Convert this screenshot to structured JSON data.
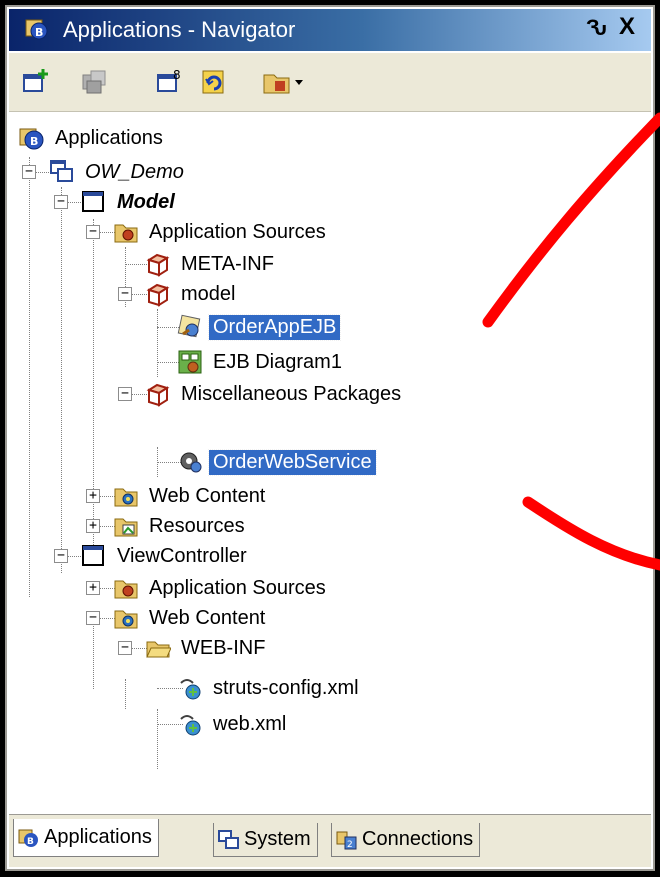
{
  "window": {
    "title": "Applications - Navigator",
    "pin_glyph": "Ԅ",
    "close_glyph": "X"
  },
  "toolbar": {
    "buttons": [
      "new-app-icon",
      "open-gray-icon",
      "new-project-icon",
      "refresh-icon",
      "folder-filter-icon"
    ]
  },
  "tree": {
    "root": "Applications",
    "workspace": "OW_Demo",
    "model": {
      "label": "Model",
      "app_sources": "Application Sources",
      "meta_inf": "META-INF",
      "pkg_model": "model",
      "order_app_ejb": "OrderAppEJB",
      "ejb_diagram": "EJB Diagram1",
      "misc_packages": "Miscellaneous Packages",
      "order_web_service": "OrderWebService",
      "web_content": "Web Content",
      "resources": "Resources"
    },
    "view_controller": {
      "label": "ViewController",
      "app_sources": "Application Sources",
      "web_content": "Web Content",
      "web_inf": "WEB-INF",
      "struts_config": "struts-config.xml",
      "web_xml": "web.xml"
    }
  },
  "tabs": [
    "Applications",
    "System",
    "Connections"
  ],
  "colors": {
    "selection": "#316ac5",
    "annotation": "#ff0000",
    "title_start": "#0a246a"
  }
}
